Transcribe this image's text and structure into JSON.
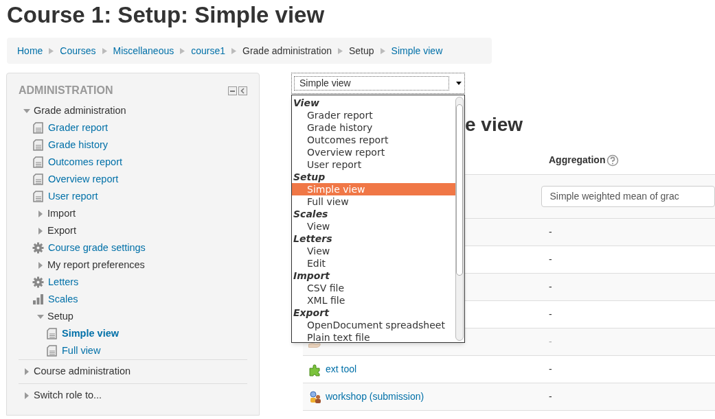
{
  "page_title": "Course 1: Setup: Simple view",
  "breadcrumb": [
    {
      "label": "Home",
      "link": true
    },
    {
      "label": "Courses",
      "link": true
    },
    {
      "label": "Miscellaneous",
      "link": true
    },
    {
      "label": "course1",
      "link": true
    },
    {
      "label": "Grade administration",
      "link": false
    },
    {
      "label": "Setup",
      "link": false
    },
    {
      "label": "Simple view",
      "link": true
    }
  ],
  "admin_block": {
    "title": "ADMINISTRATION",
    "items": [
      {
        "kind": "branch",
        "label": "Grade administration",
        "link": false,
        "expanded": true,
        "children": [
          {
            "kind": "report",
            "label": "Grader report",
            "link": true,
            "current": false
          },
          {
            "kind": "report",
            "label": "Grade history",
            "link": true,
            "current": false
          },
          {
            "kind": "report",
            "label": "Outcomes report",
            "link": true,
            "current": false
          },
          {
            "kind": "report",
            "label": "Overview report",
            "link": true,
            "current": false
          },
          {
            "kind": "report",
            "label": "User report",
            "link": true,
            "current": false
          },
          {
            "kind": "branch",
            "label": "Import",
            "link": false,
            "expanded": false
          },
          {
            "kind": "branch",
            "label": "Export",
            "link": false,
            "expanded": false
          },
          {
            "kind": "gear",
            "label": "Course grade settings",
            "link": true,
            "current": false
          },
          {
            "kind": "branch",
            "label": "My report preferences",
            "link": false,
            "expanded": false
          },
          {
            "kind": "gear",
            "label": "Letters",
            "link": true,
            "current": false
          },
          {
            "kind": "chart",
            "label": "Scales",
            "link": true,
            "current": false
          },
          {
            "kind": "branch",
            "label": "Setup",
            "link": false,
            "expanded": true,
            "children": [
              {
                "kind": "report",
                "label": "Simple view",
                "link": true,
                "current": true
              },
              {
                "kind": "report",
                "label": "Full view",
                "link": true,
                "current": false
              }
            ]
          }
        ]
      },
      {
        "kind": "branch",
        "label": "Course administration",
        "link": false,
        "expanded": false,
        "divider": true
      },
      {
        "kind": "branch",
        "label": "Switch role to...",
        "link": false,
        "expanded": false,
        "divider": true
      }
    ]
  },
  "view_select": {
    "value": "Simple view"
  },
  "view_menu": [
    {
      "label": "View",
      "options": [
        {
          "label": "Grader report",
          "selected": false
        },
        {
          "label": "Grade history",
          "selected": false
        },
        {
          "label": "Outcomes report",
          "selected": false
        },
        {
          "label": "Overview report",
          "selected": false
        },
        {
          "label": "User report",
          "selected": false
        }
      ]
    },
    {
      "label": "Setup",
      "options": [
        {
          "label": "Simple view",
          "selected": true
        },
        {
          "label": "Full view",
          "selected": false
        }
      ]
    },
    {
      "label": "Scales",
      "options": [
        {
          "label": "View",
          "selected": false
        }
      ]
    },
    {
      "label": "Letters",
      "options": [
        {
          "label": "View",
          "selected": false
        },
        {
          "label": "Edit",
          "selected": false
        }
      ]
    },
    {
      "label": "Import",
      "options": [
        {
          "label": "CSV file",
          "selected": false
        },
        {
          "label": "XML file",
          "selected": false
        }
      ]
    },
    {
      "label": "Export",
      "options": [
        {
          "label": "OpenDocument spreadsheet",
          "selected": false
        },
        {
          "label": "Plain text file",
          "selected": false
        }
      ]
    }
  ],
  "heading_visible_part": "e view",
  "table": {
    "aggregation_header": "Aggregation",
    "rows": [
      {
        "kind": "select",
        "aggregation": "Simple weighted mean of grac"
      },
      {
        "kind": "text",
        "aggregation": "-"
      },
      {
        "kind": "text",
        "aggregation": "-"
      },
      {
        "kind": "text",
        "aggregation": "-"
      },
      {
        "kind": "text",
        "aggregation": "-"
      },
      {
        "kind": "assignment",
        "dimmed": true,
        "aggregation": "-"
      },
      {
        "kind": "tool",
        "name": "ext tool",
        "dimmed": false,
        "aggregation": "-"
      },
      {
        "kind": "workshop",
        "name": "workshop (submission)",
        "dimmed": false,
        "aggregation": "-"
      }
    ]
  }
}
